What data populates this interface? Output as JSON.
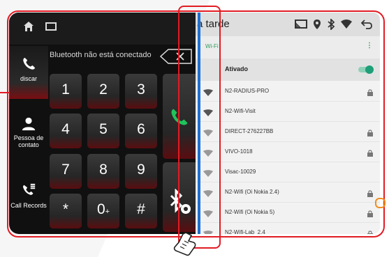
{
  "left_panel": {
    "bt_status": "Bluetooth não está conectado",
    "sidebar": [
      {
        "label": "discar",
        "icon": "phone-icon",
        "active": true
      },
      {
        "label": "Pessoa de contato",
        "icon": "contact-person-icon"
      },
      {
        "label": "Call Records",
        "icon": "call-records-icon"
      }
    ],
    "keypad": [
      {
        "main": "1"
      },
      {
        "main": "2"
      },
      {
        "main": "3"
      },
      {
        "main": "4"
      },
      {
        "main": "5"
      },
      {
        "main": "6"
      },
      {
        "main": "7"
      },
      {
        "main": "8"
      },
      {
        "main": "9"
      },
      {
        "main": "*"
      },
      {
        "main": "0",
        "sub": "+"
      },
      {
        "main": "#"
      }
    ],
    "actions": {
      "call_icon": "call-icon",
      "bt_settings_icon": "bluetooth-settings-icon"
    }
  },
  "right_panel": {
    "status_title": "a tarde",
    "wifi_header": "Wi-Fi",
    "ativado_label": "Ativado",
    "networks": [
      {
        "name": "N2-RADIUS-PRO",
        "locked": true
      },
      {
        "name": "N2-Wifi-Visit",
        "locked": false
      },
      {
        "name": "DIRECT-276227BB",
        "locked": true
      },
      {
        "name": "VIVO-1018",
        "locked": true
      },
      {
        "name": "Visac-10029",
        "locked": false
      },
      {
        "name": "N2-Wifi (Oi Nokia 2.4)",
        "locked": true
      },
      {
        "name": "N2-Wifi (Oi Nokia 5)",
        "locked": true
      },
      {
        "name": "N2-Wifi-Lab_2.4",
        "locked": true
      }
    ]
  },
  "colors": {
    "accent_red": "#e21b23",
    "call_green": "#21c35a",
    "wifi_green": "#2e9c5e",
    "bar_blue": "#1e6fd0"
  }
}
